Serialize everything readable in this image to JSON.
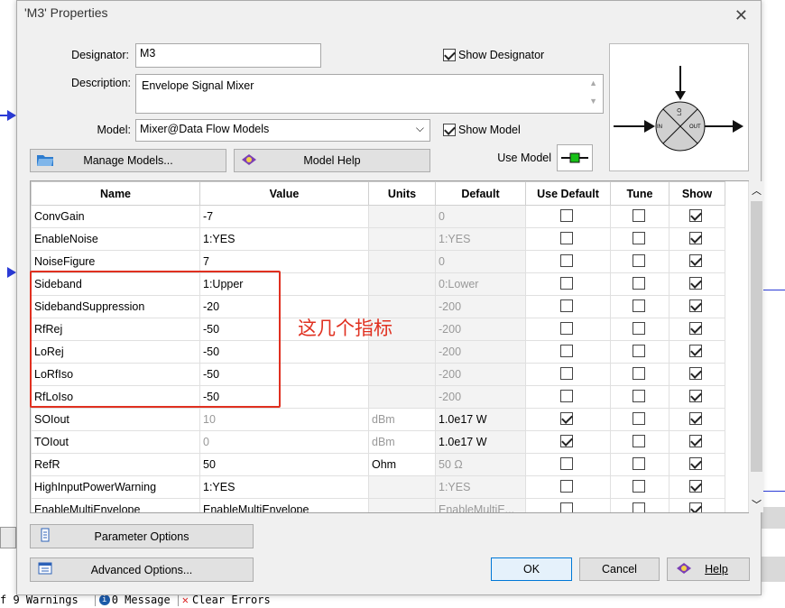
{
  "dialog": {
    "title": "'M3' Properties"
  },
  "form": {
    "designator_label": "Designator:",
    "designator_value": "M3",
    "show_designator": "Show Designator",
    "description_label": "Description:",
    "description_value": "Envelope Signal Mixer",
    "model_label": "Model:",
    "model_value": "Mixer@Data Flow Models",
    "show_model": "Show Model",
    "use_model": "Use Model"
  },
  "buttons": {
    "manage_models": "Manage Models...",
    "model_help": "Model Help",
    "parameter_options": "Parameter Options",
    "advanced_options": "Advanced Options...",
    "ok": "OK",
    "cancel": "Cancel",
    "help": "Help"
  },
  "symbol": {
    "in": "IN",
    "out": "OUT",
    "lo": "LO"
  },
  "table": {
    "headers": [
      "Name",
      "Value",
      "Units",
      "Default",
      "Use Default",
      "Tune",
      "Show"
    ],
    "rows": [
      {
        "name": "ConvGain",
        "value": "-7",
        "units": "",
        "default": "0",
        "use": false,
        "tune": false,
        "show": true,
        "dim": false
      },
      {
        "name": "EnableNoise",
        "value": "1:YES",
        "units": "",
        "default": "1:YES",
        "use": false,
        "tune": false,
        "show": true,
        "dim": false
      },
      {
        "name": "NoiseFigure",
        "value": "7",
        "units": "",
        "default": "0",
        "use": false,
        "tune": false,
        "show": true,
        "dim": false
      },
      {
        "name": "Sideband",
        "value": "1:Upper",
        "units": "",
        "default": "0:Lower",
        "use": false,
        "tune": false,
        "show": true,
        "dim": false
      },
      {
        "name": "SidebandSuppression",
        "value": "-20",
        "units": "",
        "default": "-200",
        "use": false,
        "tune": false,
        "show": true,
        "dim": false
      },
      {
        "name": "RfRej",
        "value": "-50",
        "units": "",
        "default": "-200",
        "use": false,
        "tune": false,
        "show": true,
        "dim": false
      },
      {
        "name": "LoRej",
        "value": "-50",
        "units": "",
        "default": "-200",
        "use": false,
        "tune": false,
        "show": true,
        "dim": false
      },
      {
        "name": "LoRfIso",
        "value": "-50",
        "units": "",
        "default": "-200",
        "use": false,
        "tune": false,
        "show": true,
        "dim": false
      },
      {
        "name": "RfLoIso",
        "value": "-50",
        "units": "",
        "default": "-200",
        "use": false,
        "tune": false,
        "show": true,
        "dim": false
      },
      {
        "name": "SOIout",
        "value": "10",
        "units": "dBm",
        "default": "1.0e17 W",
        "use": true,
        "tune": false,
        "show": true,
        "dim": true
      },
      {
        "name": "TOIout",
        "value": "0",
        "units": "dBm",
        "default": "1.0e17 W",
        "use": true,
        "tune": false,
        "show": true,
        "dim": true
      },
      {
        "name": "RefR",
        "value": "50",
        "units": "Ohm",
        "default": "50 Ω",
        "use": false,
        "tune": false,
        "show": true,
        "dim": false
      },
      {
        "name": "HighInputPowerWarning",
        "value": "1:YES",
        "units": "",
        "default": "1:YES",
        "use": false,
        "tune": false,
        "show": true,
        "dim": false
      },
      {
        "name": "EnableMultiEnvelope",
        "value": "EnableMultiEnvelope",
        "units": "",
        "default": "EnableMultiE...",
        "use": false,
        "tune": false,
        "show": true,
        "dim": false
      }
    ]
  },
  "annotation": {
    "text": "这几个指标",
    "color": "#e03020"
  },
  "statusbar": {
    "warnings": "f 9 Warnings",
    "messages": "0 Message",
    "clear": "Clear Errors"
  }
}
